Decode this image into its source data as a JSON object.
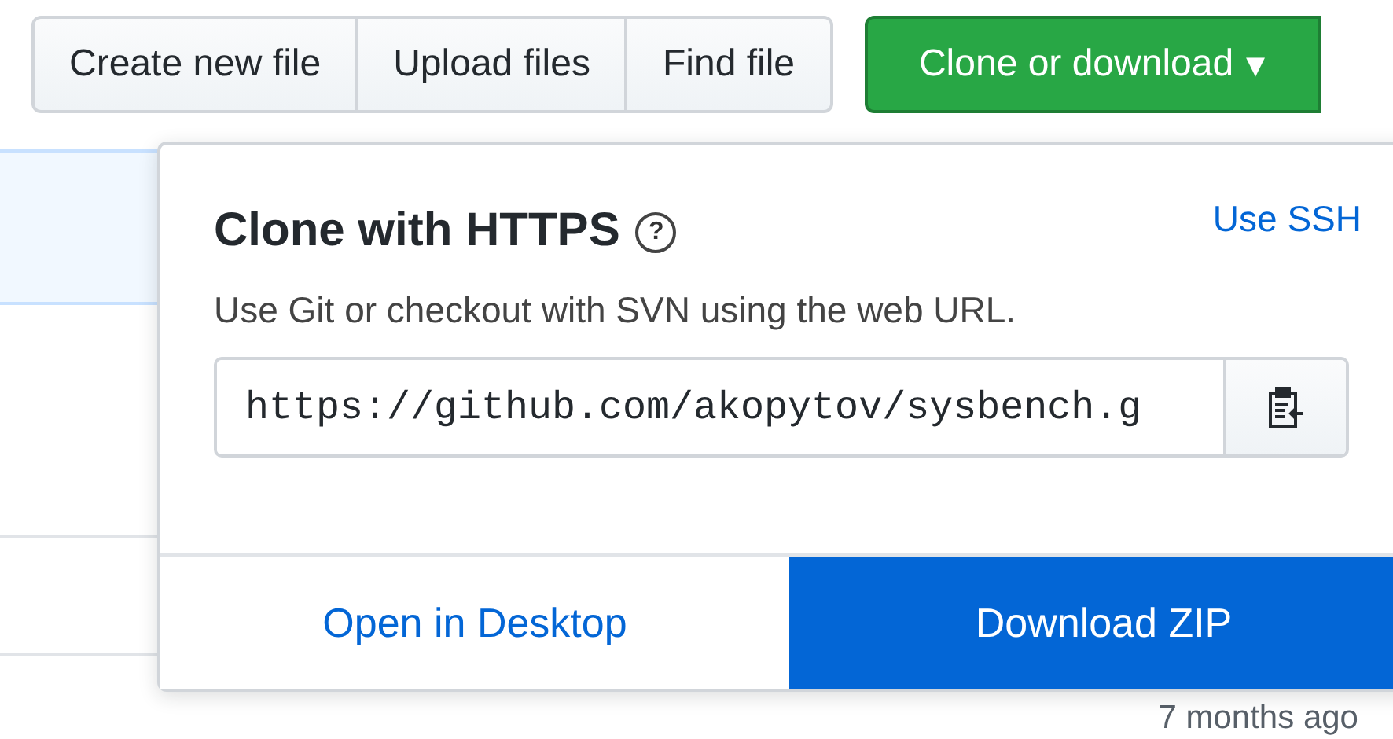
{
  "toolbar": {
    "buttons": [
      "Create new file",
      "Upload files",
      "Find file"
    ],
    "primary": {
      "label": "Clone or download",
      "caret": "▾"
    }
  },
  "popup": {
    "title": "Clone with HTTPS",
    "help": "?",
    "switch_link": "Use SSH",
    "description": "Use Git or checkout with SVN using the web URL.",
    "url": "https://github.com/akopytov/sysbench.g",
    "actions": [
      {
        "label": "Open in Desktop",
        "kind": "link"
      },
      {
        "label": "Download ZIP",
        "kind": "primary"
      }
    ]
  },
  "background": {
    "timestamp": "7 months ago"
  }
}
